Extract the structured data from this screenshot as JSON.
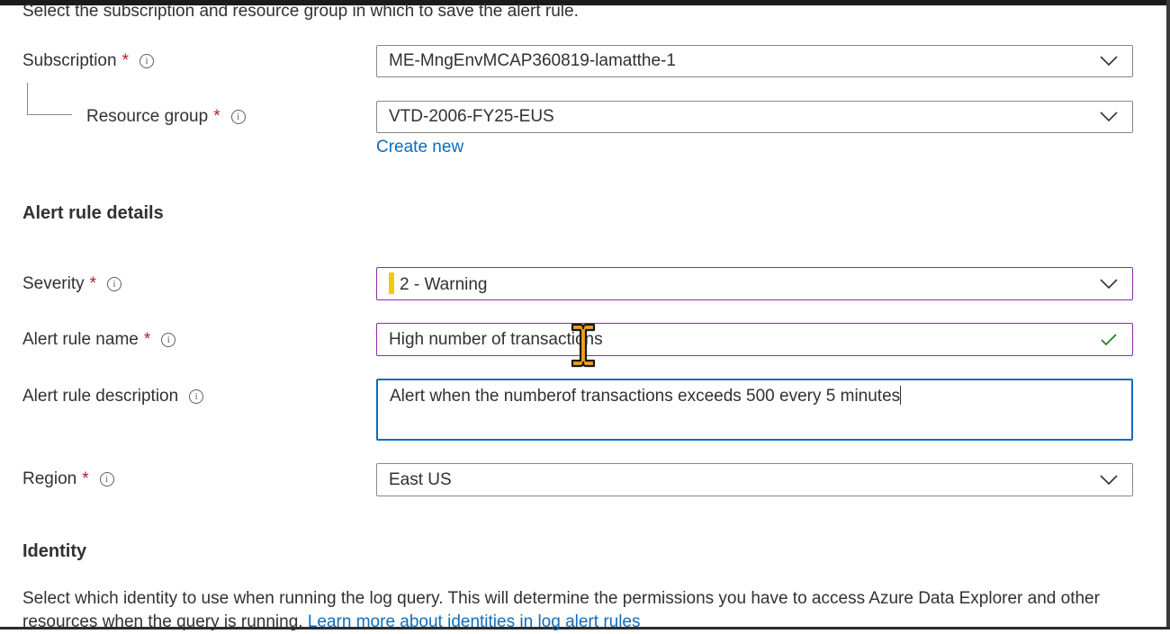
{
  "intro_text": "Select the subscription and resource group in which to save the alert rule.",
  "required_mark": "*",
  "info_glyph": "i",
  "subscription": {
    "label": "Subscription",
    "value": "ME-MngEnvMCAP360819-lamatthe-1"
  },
  "resource_group": {
    "label": "Resource group",
    "value": "VTD-2006-FY25-EUS",
    "create_new": "Create new"
  },
  "alert_rule_details": {
    "heading": "Alert rule details",
    "severity": {
      "label": "Severity",
      "value": "2 - Warning",
      "color": "#f2c811"
    },
    "name": {
      "label": "Alert rule name",
      "value": "High number of transactions"
    },
    "description": {
      "label": "Alert rule description",
      "value": "Alert when the numberof transactions exceeds 500 every 5 minutes"
    },
    "region": {
      "label": "Region",
      "value": "East US"
    }
  },
  "identity": {
    "heading": "Identity",
    "text": "Select which identity to use when running the log query. This will determine the permissions you have to access Azure Data Explorer and other resources when the query is running.",
    "link": "Learn more about identities in log alert rules"
  },
  "colors": {
    "link": "#0f6cbd",
    "required": "#a4262c",
    "valid": "#107c10",
    "focus": "#0f6cbd",
    "hover_border": "#8a2da5"
  }
}
